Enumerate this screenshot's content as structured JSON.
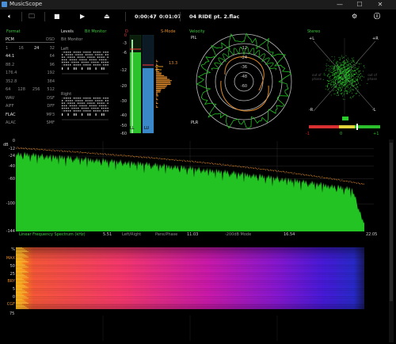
{
  "window": {
    "title": "MusicScope",
    "controls": [
      "—",
      "☐",
      "✕"
    ]
  },
  "toolbar": {
    "elapsed": "0:00:47",
    "divider": "/",
    "total": "0:01:07",
    "track": "04 RIDE pt. 2.flac"
  },
  "format": {
    "title": "Format",
    "rows": [
      [
        "PCM",
        "DSD"
      ],
      [
        "1",
        "16",
        "24",
        "32"
      ],
      [
        "44.1",
        "64"
      ],
      [
        "88.2",
        "96"
      ],
      [
        "176.4",
        "192"
      ],
      [
        "352.8",
        "384"
      ],
      [
        "64",
        "128",
        "256",
        "512"
      ],
      [
        "WAV",
        "DSF"
      ],
      [
        "AIFF",
        "DFF"
      ],
      [
        "FLAC",
        "MP3"
      ],
      [
        "ALAC",
        "SMF"
      ]
    ]
  },
  "levels": {
    "title": "Levels",
    "bit_monitor": "Bit Monitor",
    "left": "Left",
    "right": "Right",
    "dr_label": "D",
    "s_mode": "S-Mode",
    "scale": [
      "0",
      "-3",
      "-6",
      "-12",
      "-20",
      "-30",
      "-40",
      "-50",
      "-60"
    ],
    "channels": [
      "LL",
      "LU"
    ],
    "readout": "13.3"
  },
  "velocity": {
    "title": "Velocity",
    "pl": "PIL",
    "pr": "PLR",
    "rings": [
      "-12",
      "-24",
      "-36",
      "-48",
      "-60"
    ]
  },
  "stereo": {
    "title": "Stereo",
    "corners": [
      "+L",
      "+R",
      "-R",
      "-L"
    ],
    "left_note": "out of phase",
    "right_note": "out of phase",
    "correlation": [
      "-1",
      "0",
      "+1"
    ]
  },
  "spectrum": {
    "ylabel_unit": "dB",
    "y_ticks": [
      "0",
      "-12",
      "-24",
      "-40",
      "-60",
      "-100",
      "-144"
    ],
    "x_ticks": [
      "5.51",
      "11.03",
      "16.54",
      "22.05"
    ],
    "caption": "Linear Frequency Spectrum (kHz)",
    "mode_a": "Left/Right",
    "mode_b": "Pans/Phase",
    "mode_c": "-200dB Mode"
  },
  "spectrogram": {
    "y_ticks": [
      "%",
      "MAX",
      "50",
      "25",
      "BRY",
      "5",
      "0",
      "CGF"
    ],
    "bottom_tick": "75"
  },
  "colors": {
    "green": "#22c322",
    "orange": "#f08a1a",
    "blue": "#3a88c8",
    "accent": "#3ec83e"
  }
}
